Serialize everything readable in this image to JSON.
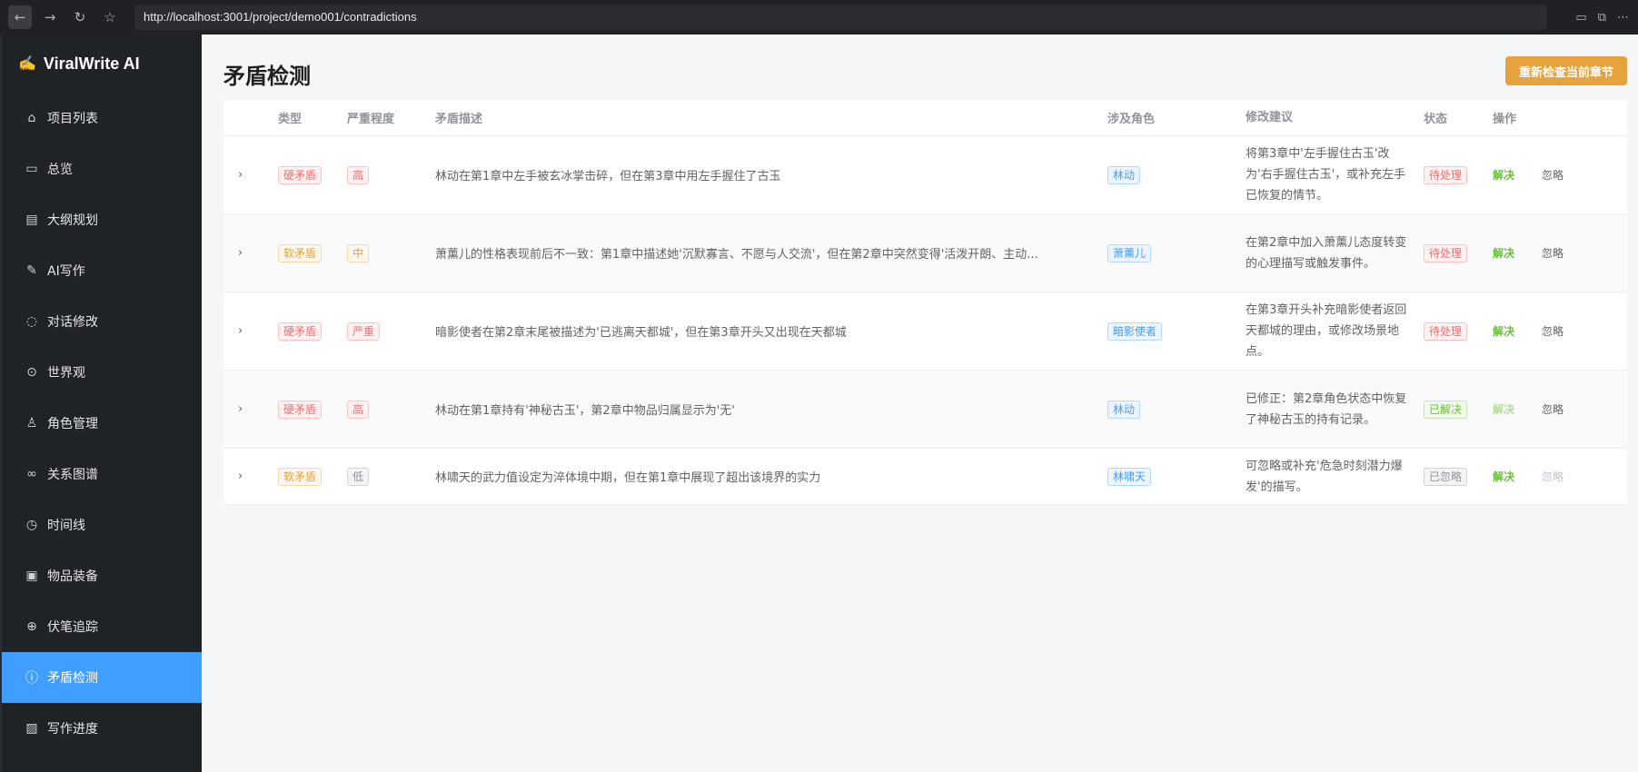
{
  "browser": {
    "url": "http://localhost:3001/project/demo001/contradictions"
  },
  "sidebar": {
    "brand": "ViralWrite AI",
    "items": [
      {
        "label": "项目列表",
        "icon": "home-icon",
        "glyph": "⌂"
      },
      {
        "label": "总览",
        "icon": "monitor-icon",
        "glyph": "▭"
      },
      {
        "label": "大纲规划",
        "icon": "document-icon",
        "glyph": "▤"
      },
      {
        "label": "AI写作",
        "icon": "edit-icon",
        "glyph": "✎"
      },
      {
        "label": "对话修改",
        "icon": "chat-icon",
        "glyph": "◌"
      },
      {
        "label": "世界观",
        "icon": "location-icon",
        "glyph": "⊙"
      },
      {
        "label": "角色管理",
        "icon": "user-icon",
        "glyph": "♙"
      },
      {
        "label": "关系图谱",
        "icon": "link-icon",
        "glyph": "∞"
      },
      {
        "label": "时间线",
        "icon": "clock-icon",
        "glyph": "◷"
      },
      {
        "label": "物品装备",
        "icon": "briefcase-icon",
        "glyph": "▣"
      },
      {
        "label": "伏笔追踪",
        "icon": "aim-icon",
        "glyph": "⊕"
      },
      {
        "label": "矛盾检测",
        "icon": "warning-circle-icon",
        "glyph": "ⓘ"
      },
      {
        "label": "写作进度",
        "icon": "chart-icon",
        "glyph": "▨"
      }
    ],
    "active_index": 11
  },
  "main": {
    "title": "矛盾检测",
    "recheck_button": "重新检查当前章节",
    "table": {
      "headers": {
        "type": "类型",
        "severity": "严重程度",
        "description": "矛盾描述",
        "characters": "涉及角色",
        "suggestion": "修改建议",
        "status": "状态",
        "actions": "操作"
      },
      "action_labels": {
        "resolve": "解决",
        "ignore": "忽略"
      },
      "rows": [
        {
          "type": "硬矛盾",
          "type_kind": "danger",
          "severity": "高",
          "severity_kind": "danger",
          "description": "林动在第1章中左手被玄冰掌击碎，但在第3章中用左手握住了古玉",
          "character": "林动",
          "suggestion": "将第3章中'左手握住古玉'改为'右手握住古玉'，或补充左手已恢复的情节。",
          "status": "待处理",
          "status_kind": "danger",
          "resolve_disabled": false,
          "ignore_disabled": false
        },
        {
          "type": "软矛盾",
          "type_kind": "warning",
          "severity": "中",
          "severity_kind": "warning",
          "description": "萧薰儿的性格表现前后不一致：第1章中描述她'沉默寡言、不愿与人交流'，但在第2章中突然变得'活泼开朗、主动...",
          "character": "萧薰儿",
          "suggestion": "在第2章中加入萧薰儿态度转变的心理描写或触发事件。",
          "status": "待处理",
          "status_kind": "danger",
          "resolve_disabled": false,
          "ignore_disabled": false
        },
        {
          "type": "硬矛盾",
          "type_kind": "danger",
          "severity": "严重",
          "severity_kind": "danger",
          "description": "暗影使者在第2章末尾被描述为'已逃离天都城'，但在第3章开头又出现在天都城",
          "character": "暗影使者",
          "suggestion": "在第3章开头补充暗影使者返回天都城的理由，或修改场景地点。",
          "status": "待处理",
          "status_kind": "danger",
          "resolve_disabled": false,
          "ignore_disabled": false
        },
        {
          "type": "硬矛盾",
          "type_kind": "danger",
          "severity": "高",
          "severity_kind": "danger",
          "description": "林动在第1章持有'神秘古玉'，第2章中物品归属显示为'无'",
          "character": "林动",
          "suggestion": "已修正：第2章角色状态中恢复了神秘古玉的持有记录。",
          "status": "已解决",
          "status_kind": "success",
          "resolve_disabled": true,
          "ignore_disabled": false
        },
        {
          "type": "软矛盾",
          "type_kind": "warning",
          "severity": "低",
          "severity_kind": "info",
          "description": "林啸天的武力值设定为淬体境中期，但在第1章中展现了超出该境界的实力",
          "character": "林啸天",
          "suggestion": "可忽略或补充'危急时刻潜力爆发'的描写。",
          "status": "已忽略",
          "status_kind": "info",
          "resolve_disabled": false,
          "ignore_disabled": true
        }
      ]
    }
  }
}
